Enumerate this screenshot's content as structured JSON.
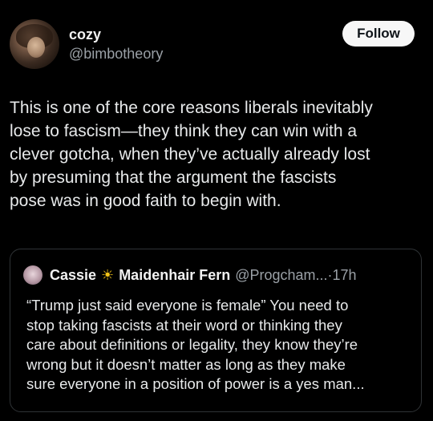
{
  "author": {
    "display_name": "cozy",
    "handle": "@bimbotheory",
    "avatar_icon": "profile-avatar"
  },
  "follow_label": "Follow",
  "tweet_lines": [
    "This is one of the core reasons liberals inevitably",
    "lose to fascism—they think they can win with a",
    "clever gotcha, when they’ve actually already lost",
    "by presuming that the argument the fascists",
    "pose was in good faith to begin with."
  ],
  "quote": {
    "name_part1": "Cassie",
    "sun_emoji": "☀",
    "name_part2": "Maidenhair Fern",
    "handle": "@Progcham...",
    "separator": "·",
    "time": "17h",
    "lines": [
      "“Trump just said everyone is female” You need to",
      "stop taking fascists at their word or thinking they",
      "care about definitions or legality, they know they’re",
      "wrong but it doesn’t matter as long as they make",
      "sure everyone in a position of power is a yes man..."
    ]
  },
  "colors": {
    "background": "#000000",
    "text": "#e7e9ea",
    "muted": "#9aa0a6",
    "border": "#2f3336",
    "button_bg": "#f7f7f7"
  }
}
